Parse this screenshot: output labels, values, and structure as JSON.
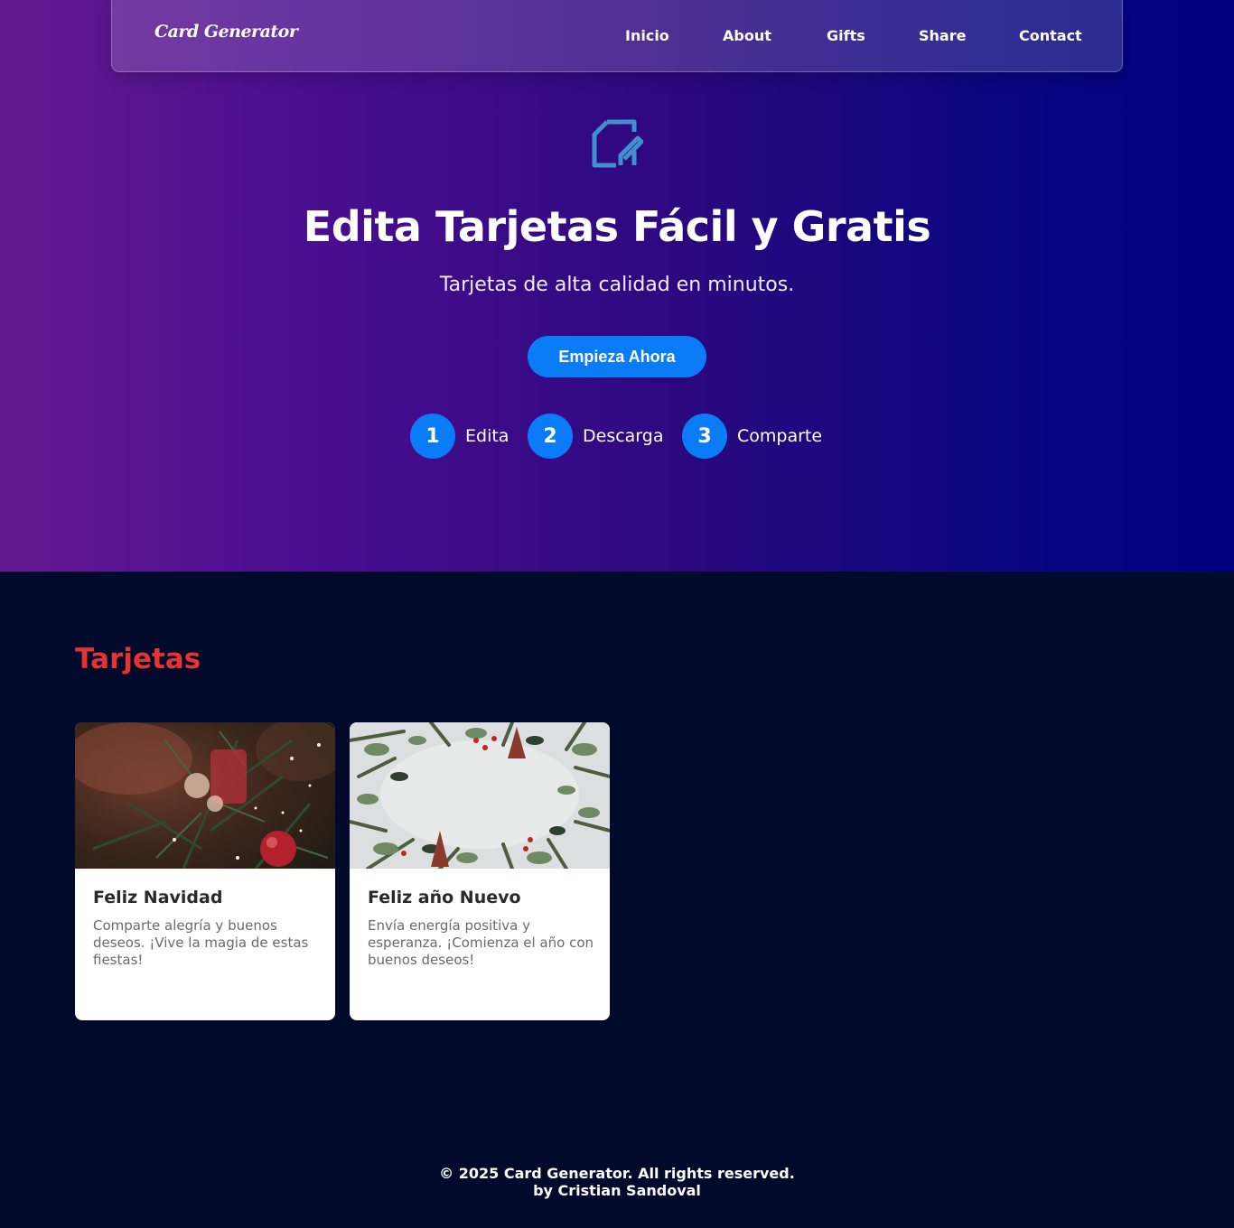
{
  "nav": {
    "logo": "Card Generator",
    "links": [
      "Inicio",
      "About",
      "Gifts",
      "Share",
      "Contact"
    ]
  },
  "hero": {
    "icon": "edit-document-icon",
    "title": "Edita Tarjetas Fácil y Gratis",
    "subtitle": "Tarjetas de alta calidad en minutos.",
    "cta_label": "Empieza Ahora",
    "steps": [
      {
        "number": "1",
        "label": "Edita"
      },
      {
        "number": "2",
        "label": "Descarga"
      },
      {
        "number": "3",
        "label": "Comparte"
      }
    ]
  },
  "cards_section": {
    "title": "Tarjetas",
    "cards": [
      {
        "title": "Feliz Navidad",
        "description": "Comparte alegría y buenos deseos. ¡Vive la magia de estas fiestas!"
      },
      {
        "title": "Feliz año Nuevo",
        "description": "Envía energía positiva y esperanza. ¡Comienza el año con buenos deseos!"
      }
    ]
  },
  "footer": {
    "copyright": "© 2025 Card Generator. All rights reserved.",
    "author": "by Cristian Sandoval"
  },
  "colors": {
    "accent_blue": "#0a7cf7",
    "section_title_red": "#e53232",
    "page_background": "#020a2b"
  }
}
